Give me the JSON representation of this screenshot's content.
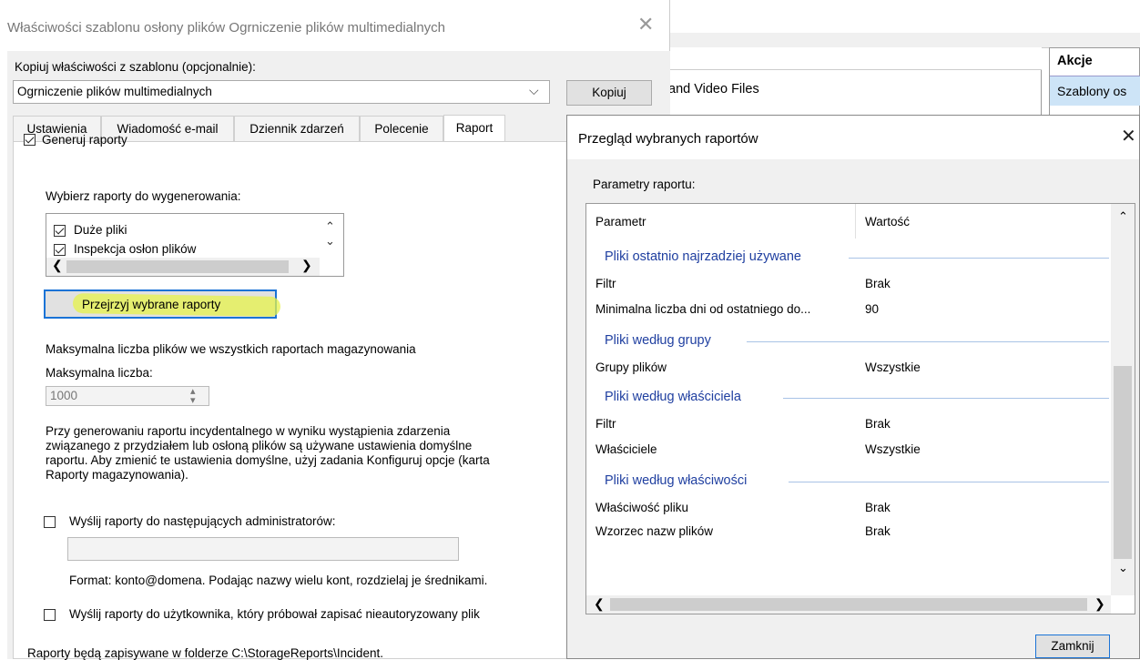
{
  "left_dialog": {
    "title": "Właściwości szablonu osłony plików Ogrniczenie plików multimedialnych",
    "copy_label": "Kopiuj właściwości z szablonu (opcjonalnie):",
    "copy_select_value": "Ogrniczenie plików multimedialnych",
    "copy_button": "Kopiuj",
    "tabs": [
      "Ustawienia",
      "Wiadomość e-mail",
      "Dziennik zdarzeń",
      "Polecenie",
      "Raport"
    ],
    "generate_reports": "Generuj raporty",
    "choose_reports_label": "Wybierz raporty do wygenerowania:",
    "report_items": [
      "Duże pliki",
      "Inspekcja osłon plików"
    ],
    "review_button": "Przejrzyj wybrane raporty",
    "max_files_label": "Maksymalna liczba plików we wszystkich raportach magazynowania",
    "max_number_label": "Maksymalna liczba:",
    "max_number_value": "1000",
    "info_text": [
      "Przy generowaniu raportu incydentalnego w wyniku wystąpienia zdarzenia",
      "związanego z przydziałem lub osłoną plików są używane ustawienia domyślne",
      "raportu. Aby zmienić te ustawienia domyślne, użyj zadania Konfiguruj opcje (karta",
      "Raporty magazynowania)."
    ],
    "send_admins_label": "Wyślij raporty do następujących administratorów:",
    "format_hint": "Format: konto@domena. Podając nazwy wielu kont, rozdzielaj je średnikami.",
    "send_user_label": "Wyślij raporty do użytkownika, który próbował zapisać nieautoryzowany plik",
    "footer_text": "Raporty będą zapisywane w folderze C:\\StorageReports\\Incident."
  },
  "background": {
    "list_item": "and Video Files",
    "actions_header": "Akcje",
    "actions_item": "Szablony os"
  },
  "right_dialog": {
    "title": "Przegląd wybranych raportów",
    "params_label": "Parametry raportu:",
    "col_param": "Parametr",
    "col_value": "Wartość",
    "sections": [
      {
        "header": "Pliki ostatnio najrzadziej używane",
        "rows": [
          {
            "param": "Filtr",
            "value": "Brak"
          },
          {
            "param": "Minimalna liczba dni od ostatniego do...",
            "value": "90"
          }
        ]
      },
      {
        "header": "Pliki według grupy",
        "rows": [
          {
            "param": "Grupy plików",
            "value": "Wszystkie"
          }
        ]
      },
      {
        "header": "Pliki według właściciela",
        "rows": [
          {
            "param": "Filtr",
            "value": "Brak"
          },
          {
            "param": "Właściciele",
            "value": "Wszystkie"
          }
        ]
      },
      {
        "header": "Pliki według właściwości",
        "rows": [
          {
            "param": "Właściwość pliku",
            "value": "Brak"
          },
          {
            "param": "Wzorzec nazw plików",
            "value": "Brak"
          }
        ]
      }
    ],
    "close_button": "Zamknij"
  }
}
